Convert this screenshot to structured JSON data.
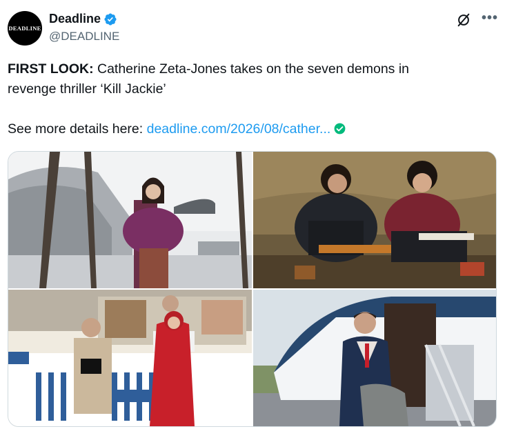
{
  "author": {
    "avatar_text": "DEADLINE",
    "display_name": "Deadline",
    "handle": "@DEADLINE",
    "verified_icon": "verified-badge-icon"
  },
  "actions": {
    "grok_icon": "grok-icon",
    "more_label": "•••"
  },
  "tweet": {
    "bold_prefix": "FIRST LOOK:",
    "line1_rest": " Catherine Zeta-Jones takes on the seven demons in",
    "line2": "revenge thriller ‘Kill Jackie’",
    "details_prefix": "See more details here: ",
    "link_text": "deadline.com/2026/08/cather...",
    "link_icon": "check-circle-icon"
  },
  "media": {
    "images": [
      {
        "name": "woman-fur-stole-museum-photo",
        "icon": "photo"
      },
      {
        "name": "two-women-sitting-floor-photo",
        "icon": "photo"
      },
      {
        "name": "ice-cream-truck-couple-photo",
        "icon": "photo"
      },
      {
        "name": "man-suit-private-jet-photo",
        "icon": "photo"
      }
    ]
  },
  "colors": {
    "accent": "#1d9bf0",
    "link_check": "#00ba7c",
    "secondary_text": "#536471"
  }
}
